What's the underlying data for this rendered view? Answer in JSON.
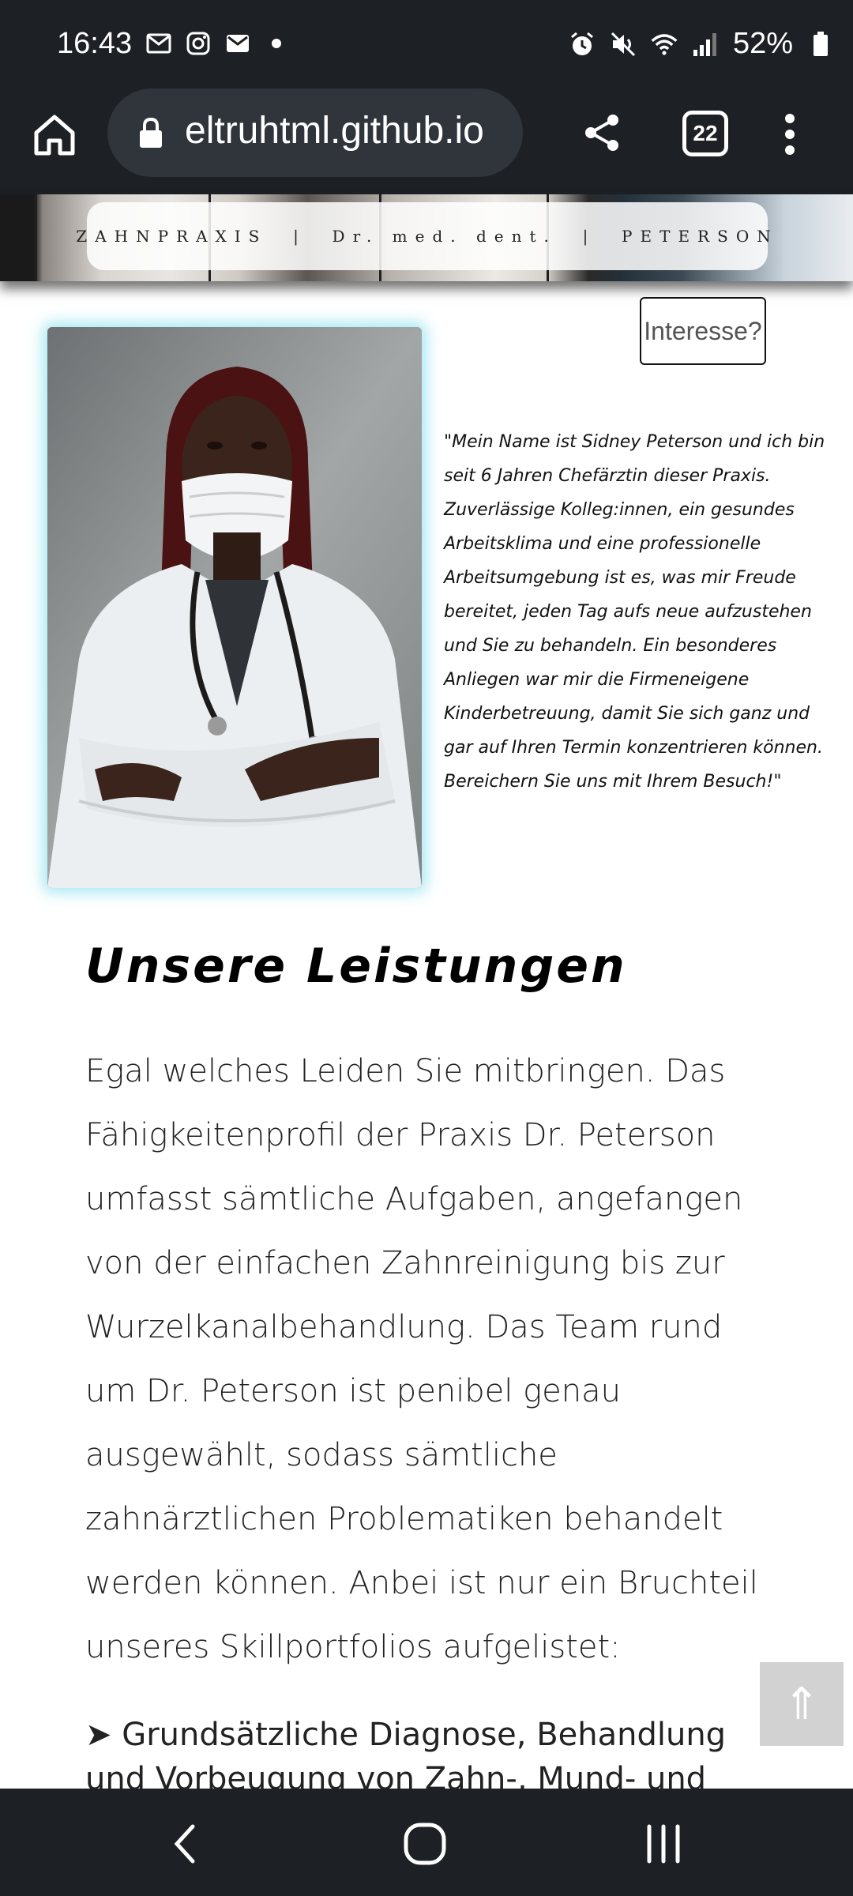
{
  "status_bar": {
    "time": "16:43",
    "left_icons": [
      "mail-icon",
      "instagram-icon",
      "gmail-icon",
      "dot-icon"
    ],
    "right_icons": [
      "alarm-icon",
      "mute-icon",
      "wifi-icon",
      "signal-icon"
    ],
    "battery_percent": "52%"
  },
  "browser": {
    "url": "eltruhtml.github.io",
    "tab_count": "22",
    "icons": [
      "home-icon",
      "lock-icon",
      "share-icon",
      "tabs-icon",
      "more-menu-icon"
    ]
  },
  "banner": {
    "text": "ZAHNPRAXIS  |  Dr. med. dent.  |  PETERSON"
  },
  "interest_button": {
    "label": "Interesse?"
  },
  "doctor": {
    "quote": "\"Mein Name ist Sidney Peterson und ich bin seit 6 Jahren Chefärztin dieser Praxis. Zuverlässige Kolleg:innen, ein gesundes Arbeitsklima und eine professionelle Arbeitsumgebung ist es, was mir Freude bereitet, jeden Tag aufs neue aufzustehen und Sie zu behandeln. Ein besonderes Anliegen war mir die Firmeneigene Kinderbetreuung, damit Sie sich ganz und gar auf Ihren Termin konzentrieren können. Bereichern Sie uns mit Ihrem Besuch!\""
  },
  "services": {
    "title": "Unsere Leistungen",
    "body": "Egal welches Leiden Sie mitbringen. Das Fähigkeitenprofil der Praxis Dr. Peterson umfasst sämtliche Aufgaben, angefangen von der einfachen Zahnreinigung bis zur Wurzelkanalbehandlung. Das Team rund um Dr. Peterson ist penibel genau ausgewählt, sodass sämtliche zahnärztlichen Problematiken behandelt werden können. Anbei ist nur ein Bruchteil unseres Skillportfolios aufgelistet:",
    "first_item": "➤ Grundsätzliche Diagnose, Behandlung und Vorbeugung von Zahn-, Mund- und"
  },
  "scroll_top": {
    "icon": "arrow-up-icon",
    "glyph": "⇑"
  },
  "nav_bar": {
    "icons": [
      "back-icon",
      "home-circle-icon",
      "recents-icon"
    ]
  }
}
